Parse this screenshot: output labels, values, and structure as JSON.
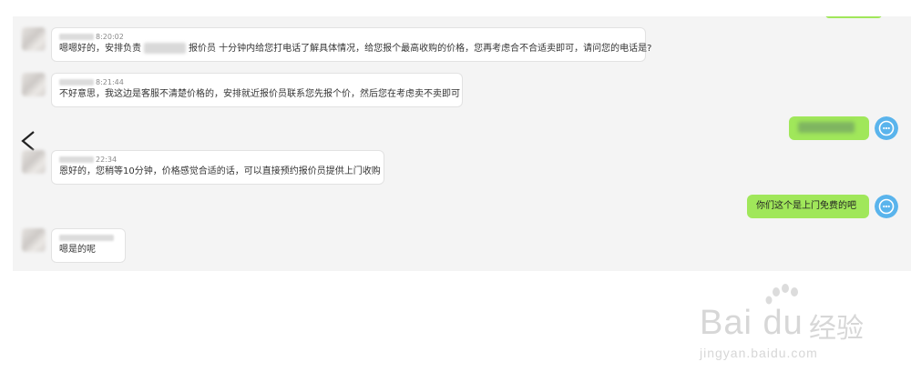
{
  "chat": {
    "messages": [
      {
        "side": "left",
        "time": "8:20:02",
        "segments": [
          "嗯嗯好的，安排负责",
          "报价员 十分钟内给您打电话了解具体情况，给您报个最高收购的价格，您再考虑合不合适卖即可，请问您的电话是?"
        ]
      },
      {
        "side": "left",
        "time": "8:21:44",
        "text": "不好意思，我这边是客服不清楚价格的，安排就近报价员联系您先报个价，然后您在考虑卖不卖即可"
      },
      {
        "side": "right",
        "text": "",
        "redacted": true
      },
      {
        "side": "left",
        "time": "22:34",
        "text": "恩好的，您稍等10分钟，价格感觉合适的话，可以直接预约报价员提供上门收购"
      },
      {
        "side": "right",
        "text": "你们这个是上门免费的吧"
      },
      {
        "side": "left",
        "time": "",
        "text": "嗯是的呢"
      }
    ]
  },
  "watermark": {
    "brand": "Bai du",
    "product": "经验",
    "url": "jingyan.baidu.com"
  },
  "colors": {
    "panel_bg": "#f4f4f4",
    "own_bubble": "#a0e75a",
    "agent_avatar": "#5ab4ec",
    "watermark": "#d7d7d7"
  }
}
